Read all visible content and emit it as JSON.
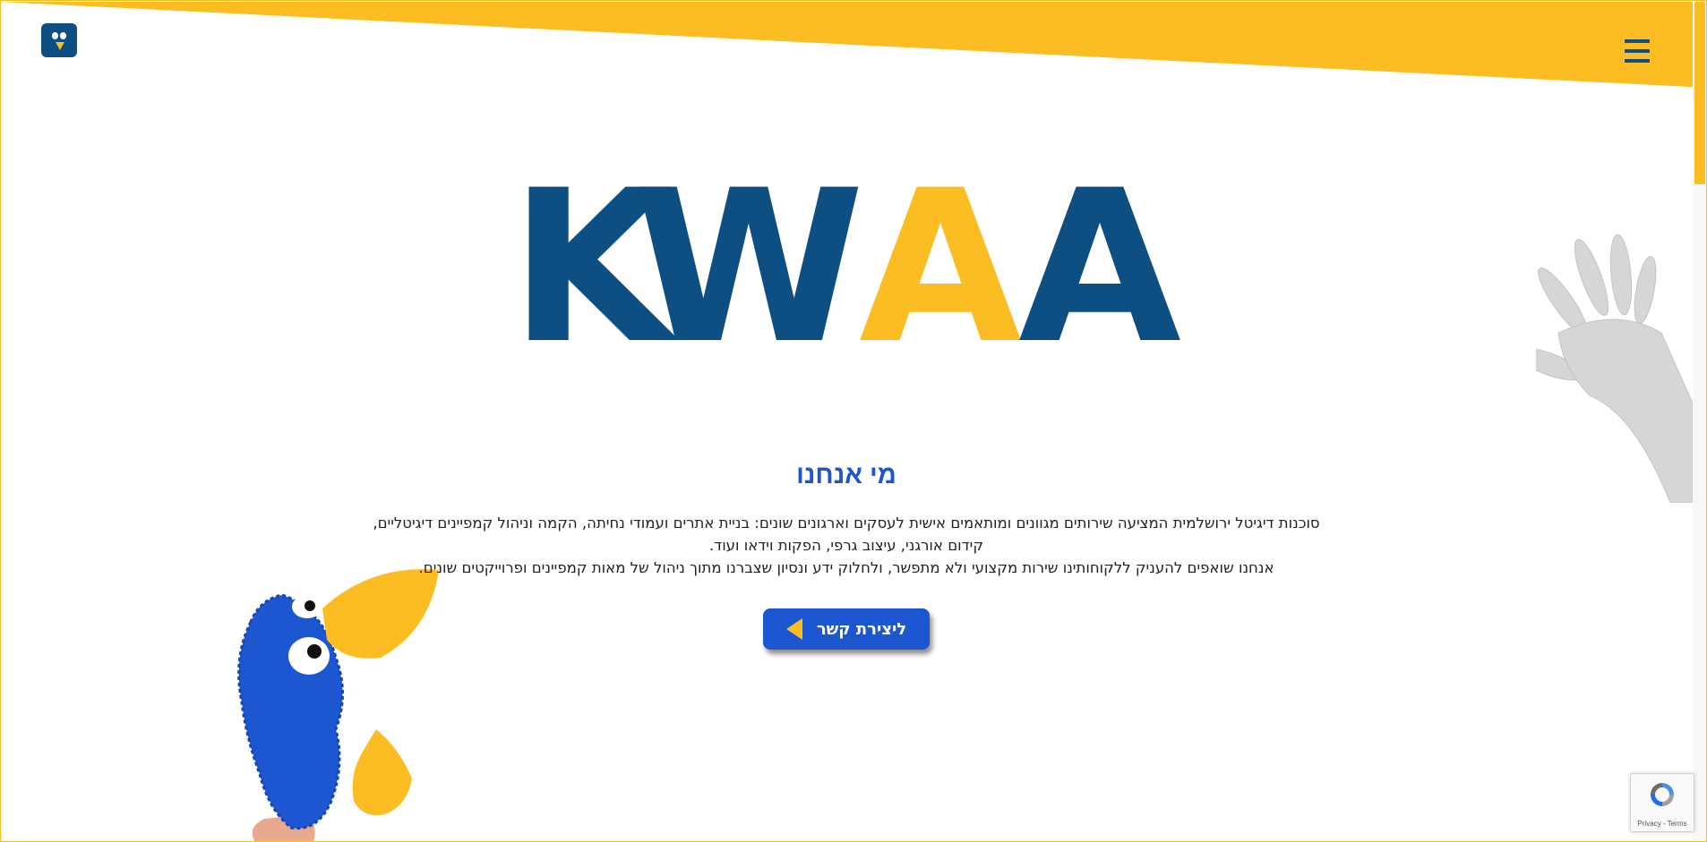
{
  "header": {
    "logo_icon": "owl-logo-icon",
    "menu_icon": "hamburger-menu-icon"
  },
  "brand": {
    "wordmark_letters": [
      "K",
      "W",
      "A",
      "A"
    ],
    "colors": {
      "primary_blue": "#0d4f82",
      "accent_yellow": "#fbbd22",
      "cta_blue": "#1c56d1"
    }
  },
  "about": {
    "title": "מי אנחנו",
    "line1": "סוכנות דיגיטל ירושלמית המציעה שירותים מגוונים ומותאמים אישית לעסקים וארגונים שונים: בניית אתרים ועמודי נחיתה, הקמה וניהול קמפיינים דיגיטליים,",
    "line2": "קידום אורגני, עיצוב גרפי, הפקות וידאו ועוד.",
    "line3": "אנחנו שואפים להעניק ללקוחותינו שירות מקצועי ולא מתפשר, ולחלוק ידע ונסיון שצברנו מתוך ניהול של מאות קמפיינים ופרוייקטים שונים."
  },
  "cta": {
    "label": "ליצירת קשר",
    "icon": "arrow-left-icon"
  },
  "decorations": {
    "parrot": "parrot-puppet-illustration",
    "hand": "waving-hand-illustration"
  },
  "recaptcha": {
    "links": "Privacy - Terms"
  }
}
